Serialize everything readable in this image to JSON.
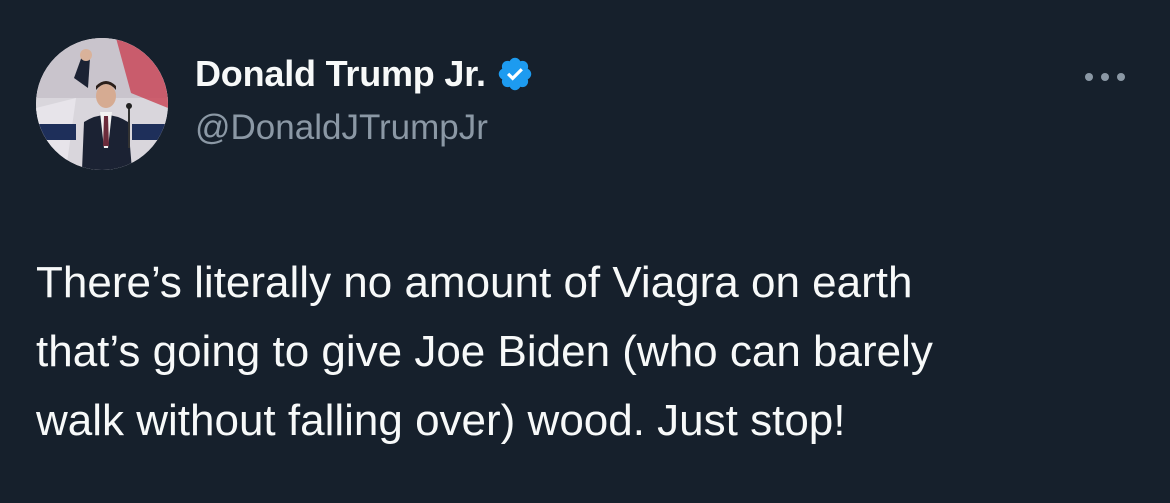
{
  "colors": {
    "background": "#16202c",
    "text_primary": "#f7f9f9",
    "text_secondary": "#8b98a5",
    "verified_badge": "#1d9bf0"
  },
  "author": {
    "display_name": "Donald Trump Jr.",
    "handle": "@DonaldJTrumpJr",
    "verified": true,
    "avatar_icon": "profile-photo"
  },
  "tweet": {
    "lines": [
      "There’s literally no amount of Viagra on earth",
      "that’s going to give Joe Biden (who can barely",
      "walk without falling over) wood. Just stop!"
    ]
  },
  "actions": {
    "more_icon": "more-options-icon"
  }
}
